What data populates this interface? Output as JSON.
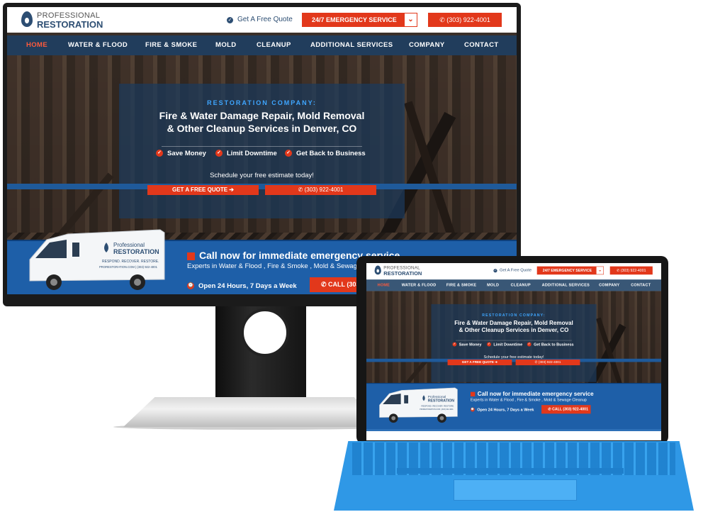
{
  "site": {
    "logo": {
      "line1": "PROFESSIONAL",
      "line2": "RESTORATION"
    },
    "header": {
      "quote_link": "Get A Free Quote",
      "emergency": "24/7 EMERGENCY SERVICE",
      "phone": "(303) 922-4001"
    },
    "nav": [
      "HOME",
      "WATER & FLOOD",
      "FIRE & SMOKE",
      "MOLD",
      "CLEANUP",
      "ADDITIONAL SERVICES",
      "COMPANY",
      "CONTACT"
    ],
    "hero": {
      "subtitle": "RESTORATION COMPANY:",
      "title_line1": "Fire & Water Damage Repair, Mold Removal",
      "title_line2": "& Other Cleanup Services in Denver, CO",
      "benefits": [
        "Save Money",
        "Limit Downtime",
        "Get Back to Business"
      ],
      "schedule": "Schedule your free estimate today!",
      "btn_quote": "GET A FREE QUOTE",
      "btn_phone": "(303) 922-4001"
    },
    "band": {
      "call_title": "Call now for immediate emergency service",
      "call_sub": "Experts in Water & Flood , Fire & Smoke , Mold & Sewage Cleanup",
      "open": "Open 24 Hours, 7 Days a Week",
      "call_btn": "CALL (303) 922-4001",
      "van_logo1": "Professional",
      "van_logo2": "RESTORATION",
      "van_tag": "RESPOND. RECOVER. RESTORE.",
      "van_url": "PRORESTORATION.COM | (303) 922-4001"
    }
  },
  "colors": {
    "brand": "#2d4e73",
    "accent": "#e2381b",
    "nav_bg": "#1e4063",
    "band": "#1e5fa8",
    "keyboard": "#2f98e6"
  }
}
